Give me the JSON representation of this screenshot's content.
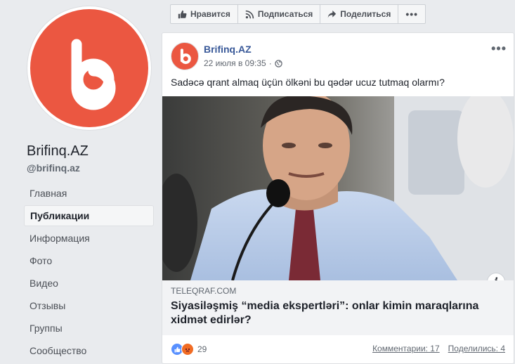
{
  "page": {
    "name": "Brifinq.AZ",
    "handle": "@brifinq.az"
  },
  "nav": [
    {
      "label": "Главная",
      "active": false
    },
    {
      "label": "Публикации",
      "active": true
    },
    {
      "label": "Информация",
      "active": false
    },
    {
      "label": "Фото",
      "active": false
    },
    {
      "label": "Видео",
      "active": false
    },
    {
      "label": "Отзывы",
      "active": false
    },
    {
      "label": "Группы",
      "active": false
    },
    {
      "label": "Сообщество",
      "active": false
    }
  ],
  "actions": {
    "like": "Нравится",
    "subscribe": "Подписаться",
    "share": "Поделиться"
  },
  "post": {
    "author": "Brifinq.AZ",
    "time": "22 июля в 09:35",
    "text": "Sadəcə qrant almaq üçün ölkəni bu qədər ucuz tutmaq olarmı?",
    "link": {
      "domain": "TELEQRAF.COM",
      "title": "Siyasiləşmiş “media ekspertləri”: onlar kimin maraqlarına xidmət edirlər?"
    },
    "reactions_count": "29",
    "comments": "Комментарии: 17",
    "shares": "Поделились: 4"
  },
  "colors": {
    "brand": "#eb5741",
    "link": "#385898"
  }
}
